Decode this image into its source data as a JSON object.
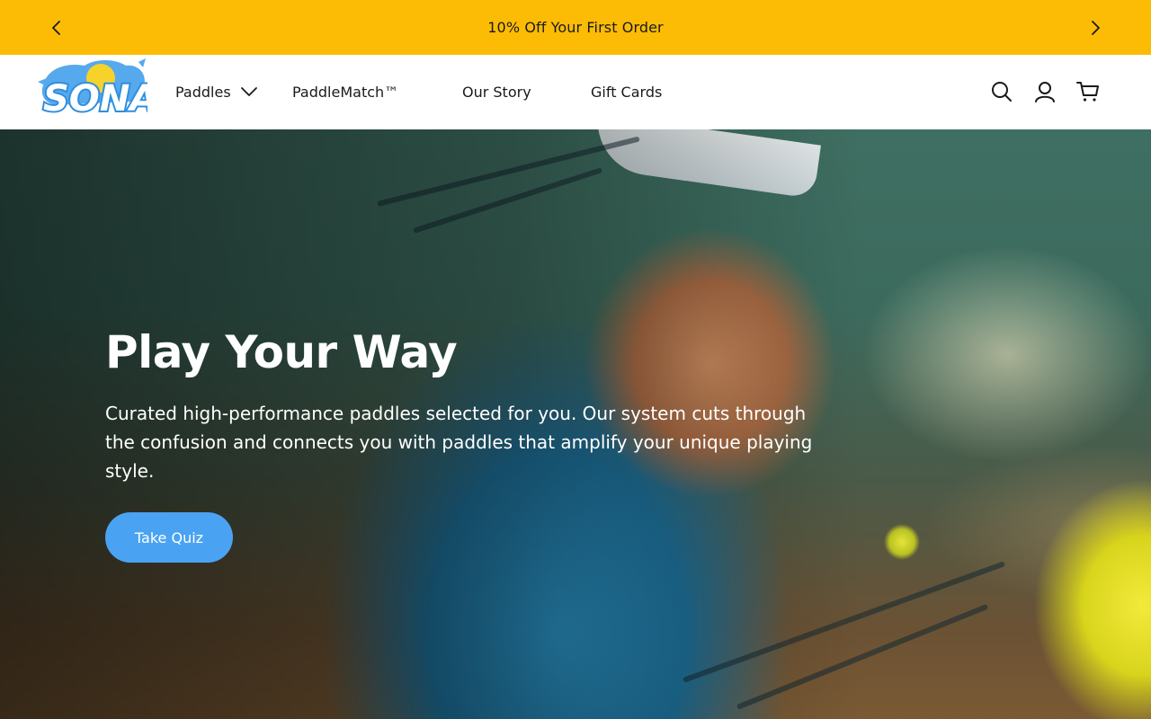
{
  "announcement": {
    "text": "10% Off Your First Order",
    "prev_icon": "chevron-left-icon",
    "next_icon": "chevron-right-icon"
  },
  "header": {
    "logo_text": "SONA",
    "nav": [
      {
        "label": "Paddles",
        "has_dropdown": true,
        "icon": "chevron-down-icon"
      },
      {
        "label": "PaddleMatch™"
      },
      {
        "label": "Our Story"
      },
      {
        "label": "Gift Cards"
      }
    ],
    "icons": [
      "search-icon",
      "account-icon",
      "cart-icon"
    ]
  },
  "hero": {
    "title": "Play Your Way",
    "description": "Curated high-performance paddles selected for you. Our system cuts through the confusion and connects you with paddles that amplify your unique playing style.",
    "cta_label": "Take Quiz"
  },
  "colors": {
    "announcement_bg": "#fcbc05",
    "cta_bg": "#4aa3f2",
    "text_dark": "#1a1a1a",
    "logo_blue": "#2f8fe0",
    "logo_yellow": "#f6d22a"
  }
}
